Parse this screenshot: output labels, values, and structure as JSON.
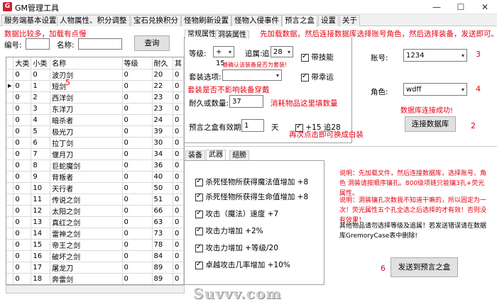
{
  "window": {
    "title": "GM管理工具",
    "minimize": "—",
    "maximize": "☐",
    "close": "✕"
  },
  "tabs": [
    {
      "label": "服务端基本设置"
    },
    {
      "label": "人物属性、积分调整"
    },
    {
      "label": "宝石兑换积分"
    },
    {
      "label": "怪物刷新设置"
    },
    {
      "label": "怪物入侵事件"
    },
    {
      "label": "预言之盒"
    },
    {
      "label": "设置"
    },
    {
      "label": "关于"
    }
  ],
  "left": {
    "notice": "数据比较多，加载有点慢",
    "code_label": "编号:",
    "name_label": "名称:",
    "query_button": "查询",
    "columns": [
      "大类",
      "小类",
      "名称",
      "等级",
      "耐久",
      "其"
    ],
    "rows": [
      [
        "0",
        "0",
        "波刃剑",
        "0",
        "20",
        "0"
      ],
      [
        "0",
        "1",
        "短剑",
        "0",
        "22",
        "0"
      ],
      [
        "0",
        "2",
        "西洋剑",
        "0",
        "23",
        "0"
      ],
      [
        "0",
        "3",
        "东洋刀",
        "0",
        "23",
        "0"
      ],
      [
        "0",
        "4",
        "暗杀者",
        "0",
        "24",
        "0"
      ],
      [
        "0",
        "5",
        "极光刀",
        "0",
        "39",
        "0"
      ],
      [
        "0",
        "6",
        "拉丁剑",
        "0",
        "30",
        "0"
      ],
      [
        "0",
        "7",
        "偃月刀",
        "0",
        "34",
        "0"
      ],
      [
        "0",
        "8",
        "巨蛇魔剑",
        "0",
        "36",
        "0"
      ],
      [
        "0",
        "9",
        "背叛者",
        "0",
        "40",
        "0"
      ],
      [
        "0",
        "10",
        "天行者",
        "0",
        "50",
        "0"
      ],
      [
        "0",
        "11",
        "传说之剑",
        "0",
        "51",
        "0"
      ],
      [
        "0",
        "12",
        "太阳之剑",
        "0",
        "66",
        "0"
      ],
      [
        "0",
        "13",
        "真红之剑",
        "0",
        "63",
        "0"
      ],
      [
        "0",
        "14",
        "雷神之剑",
        "0",
        "73",
        "0"
      ],
      [
        "0",
        "15",
        "帝王之剑",
        "0",
        "78",
        "0"
      ],
      [
        "0",
        "16",
        "破坏之剑",
        "0",
        "84",
        "0"
      ],
      [
        "0",
        "17",
        "屠龙刀",
        "0",
        "89",
        "0"
      ],
      [
        "0",
        "18",
        "奔雷剑",
        "0",
        "89",
        "0"
      ]
    ],
    "annot5": "5"
  },
  "mid": {
    "subtabs": [
      "常规属性",
      "洞装属性"
    ],
    "level_label": "等级:",
    "level_value": "+ 15",
    "append_label": "追属:",
    "append_prefix": "追",
    "append_value": "28",
    "skill_check": "带技能",
    "warn_set": "请确认该装备是否为套装!",
    "set_label": "套装选项:",
    "luck_check": "带幸运",
    "set_note": "套装是否不影响装备穿戴",
    "dur_label": "耐久或数量:",
    "dur_value": "37",
    "dur_note": "消耗物品这里填数量",
    "valid_label": "预言之盒有效期:",
    "valid_value": "1",
    "valid_unit": "天",
    "plus_check": "+15 追28",
    "plus_note": "再次点击即可换成白装",
    "top_note": "先加载数据，然后连接数据库选择账号角色，然后选择装备，发送即可。"
  },
  "right": {
    "account_label": "账号:",
    "account_value": "1234",
    "annot3": "3",
    "role_label": "角色:",
    "role_value": "wdff",
    "annot4": "4",
    "db_ok": "数据库连接成功!",
    "connect_button": "连接数据库",
    "annot2": "2"
  },
  "lower": {
    "tabs": [
      "装备",
      "武器",
      "翅膀"
    ],
    "options": [
      {
        "label": "杀死怪物所获得魔法值增加 +8",
        "checked": true
      },
      {
        "label": "杀死怪物所获得生命值增加 +8",
        "checked": true
      },
      {
        "label": "攻击（魔法）速度 +7",
        "checked": true
      },
      {
        "label": "攻击力增加 +2%",
        "checked": true
      },
      {
        "label": "攻击力增加 +等级/20",
        "checked": true
      },
      {
        "label": "卓越攻击几率增加 +10%",
        "checked": true
      }
    ],
    "info1": "说明：先加载文件，然后连接数据库，选择账号、角色 洞装请按顺序镶孔。800级项链只能镶3孔+荧光属性。",
    "info2": "说明：洞装镶孔次数我不知道干嘛的，所以固定为一次！荧光属性五个孔全选之后选择的才有效！否则没有效果！",
    "info3": "其他物品请勿选择等级及追属！若发送错误请在数据库GremoryCase表中删除!",
    "annot6": "6",
    "send_button": "发送到预言之盒"
  },
  "watermark": "Suvvv.com"
}
